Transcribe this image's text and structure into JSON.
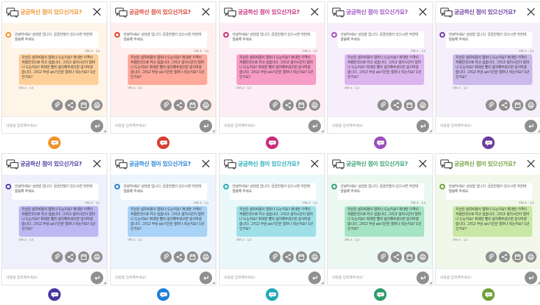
{
  "widget_text": {
    "title": "궁금하신 점이 있으신가요?",
    "bot_message": "안녕하세요! 상담원 입니다. 궁금한점이 있으시면 저한테 말씀해 주세요.",
    "bot_time": "PM 4 : 14",
    "user_message": "우산은 설치비용이 얼마나 드는지요? 최대한 가격이 저렴한것으로 하고 싶습니다. 그리고 설치시간이 얼마나 드는지요? 최대한 빨리 설치해주셨으면 감사하겠습니다. 그리고 무상 a/s기간은 얼마나 되는지요? 1년 인가요?",
    "user_time": "PM 4 : 14",
    "input_placeholder": "내용을 입력해주세요!",
    "actions": [
      "attach-icon",
      "share-icon",
      "calendar-icon",
      "print-icon"
    ],
    "send_icon": "enter-icon"
  },
  "themes": [
    {
      "accent": "#f0932b",
      "title_color": "#f0932b",
      "bg": "#fff4e8",
      "bubble": "#ffcf9a"
    },
    {
      "accent": "#d9402f",
      "title_color": "#d9402f",
      "bg": "#fff0ed",
      "bubble": "#ffa99b"
    },
    {
      "accent": "#c72c7a",
      "title_color": "#c72c7a",
      "bg": "#fdeef5",
      "bubble": "#f79cc6"
    },
    {
      "accent": "#9b4fbf",
      "title_color": "#9b4fbf",
      "bg": "#f7eefb",
      "bubble": "#dcb5ef"
    },
    {
      "accent": "#6a3d9e",
      "title_color": "#6a3d9e",
      "bg": "#f4effa",
      "bubble": "#cbb9ea"
    },
    {
      "accent": "#4a35a0",
      "title_color": "#4a35a0",
      "bg": "#f0f0fc",
      "bubble": "#bdb7f2"
    },
    {
      "accent": "#1f7fd6",
      "title_color": "#1f7fd6",
      "bg": "#ecf5fd",
      "bubble": "#a9d3f6"
    },
    {
      "accent": "#21a9b8",
      "title_color": "#21a9b8",
      "bg": "#eaf8fa",
      "bubble": "#9fe0e8"
    },
    {
      "accent": "#2e9c6b",
      "title_color": "#2e9c6b",
      "bg": "#ebf8f1",
      "bubble": "#a5e4c5"
    },
    {
      "accent": "#6fa03a",
      "title_color": "#6fa03a",
      "bg": "#f2f8e9",
      "bubble": "#c9e8a5"
    }
  ]
}
